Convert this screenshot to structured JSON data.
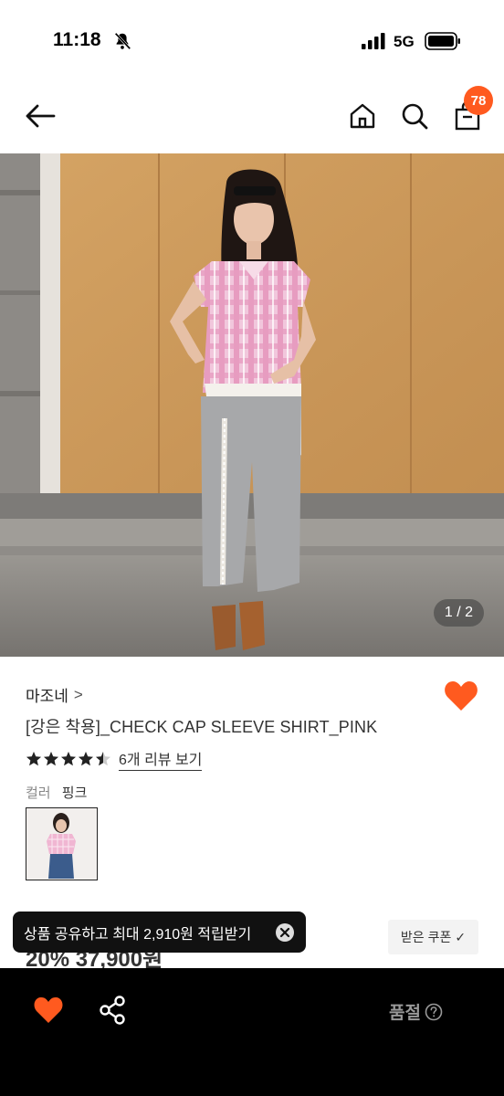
{
  "status_bar": {
    "time": "11:18",
    "network": "5G"
  },
  "nav": {
    "cart_count": "78"
  },
  "gallery": {
    "counter": "1 / 2"
  },
  "product": {
    "brand": "마조네",
    "brand_chevron": ">",
    "title": "[강은 착용]_CHECK CAP SLEEVE SHIRT_PINK",
    "rating": 4.5,
    "review_link": "6개 리뷰 보기",
    "color_label": "컬러",
    "color_value": "핑크"
  },
  "coupon": {
    "label": "받은 쿠폰",
    "check": "✓"
  },
  "price_peek": "20% 37,900원",
  "toast": {
    "text": "상품 공유하고 최대 2,910원 적립받기"
  },
  "bottom_bar": {
    "soldout_label": "품절"
  },
  "colors": {
    "accent": "#ff5a1f",
    "bottom_bar_bg": "#000000",
    "toast_bg": "#111111"
  },
  "icons": [
    "back-arrow-icon",
    "home-icon",
    "search-icon",
    "shopping-bag-icon",
    "heart-icon",
    "star-icon",
    "share-icon",
    "close-icon",
    "help-icon",
    "bell-off-icon"
  ]
}
